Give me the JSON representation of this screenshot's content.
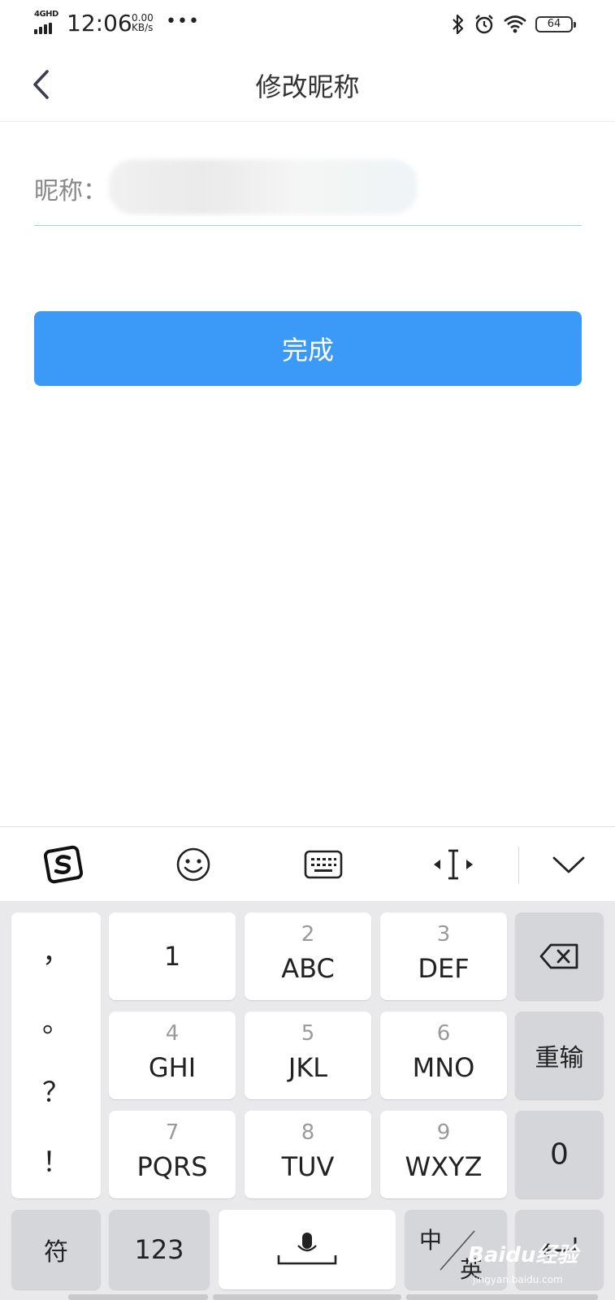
{
  "status_bar": {
    "network": "4GHD",
    "time": "12:06",
    "speed_value": "0.00",
    "speed_unit": "KB/s",
    "more": "•••",
    "battery": "64"
  },
  "nav": {
    "title": "修改昵称"
  },
  "form": {
    "nickname_label": "昵称：",
    "nickname_value": ""
  },
  "actions": {
    "done_label": "完成"
  },
  "keyboard": {
    "toolbar_icons": [
      "sogou-logo-icon",
      "emoji-icon",
      "keyboard-icon",
      "cursor-move-icon",
      "collapse-icon"
    ],
    "punctuation": [
      "，",
      "。",
      "？",
      "！"
    ],
    "keys": {
      "k1": {
        "main": "1"
      },
      "k2": {
        "sub": "2",
        "main": "ABC"
      },
      "k3": {
        "sub": "3",
        "main": "DEF"
      },
      "k4": {
        "sub": "4",
        "main": "GHI"
      },
      "k5": {
        "sub": "5",
        "main": "JKL"
      },
      "k6": {
        "sub": "6",
        "main": "MNO"
      },
      "k7": {
        "sub": "7",
        "main": "PQRS"
      },
      "k8": {
        "sub": "8",
        "main": "TUV"
      },
      "k9": {
        "sub": "9",
        "main": "WXYZ"
      }
    },
    "reenter_label": "重输",
    "zero_label": "0",
    "symbol_label": "符",
    "numeric_label": "123",
    "lang_zh": "中",
    "lang_en": "英"
  },
  "watermark": {
    "brand": "Baidu经验",
    "url": "jingyan.baidu.com"
  }
}
